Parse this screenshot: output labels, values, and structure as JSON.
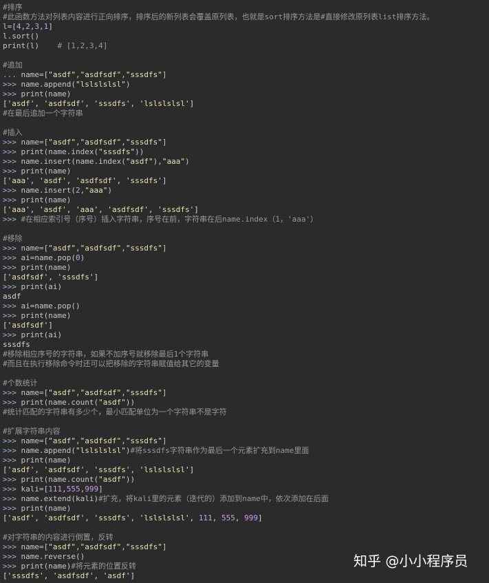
{
  "colors": {
    "background": "#2b2b2b",
    "text": "#c8c8c8",
    "comment": "#9a9a9a",
    "prompt": "#9cb6d8",
    "string": "#e9e4b0",
    "number": "#c8a2e6"
  },
  "watermark": "知乎 @小小程序员",
  "lines": [
    [
      {
        "t": "#排序",
        "k": "comment"
      }
    ],
    [
      {
        "t": "#此函数方法对列表内容进行正向排序，排序后的新列表会覆盖原列表，也就是sort排序方法是#直接修改原列表list排序方法。",
        "k": "comment"
      }
    ],
    [
      {
        "t": "l=[",
        "k": "default"
      },
      {
        "t": "4",
        "k": "number"
      },
      {
        "t": ",",
        "k": "default"
      },
      {
        "t": "2",
        "k": "number"
      },
      {
        "t": ",",
        "k": "default"
      },
      {
        "t": "3",
        "k": "number"
      },
      {
        "t": ",",
        "k": "default"
      },
      {
        "t": "1",
        "k": "number"
      },
      {
        "t": "]",
        "k": "default"
      }
    ],
    [
      {
        "t": "l.sort()",
        "k": "default"
      }
    ],
    [
      {
        "t": "print(l)    ",
        "k": "default"
      },
      {
        "t": "# [1,2,3,4]",
        "k": "comment"
      }
    ],
    [],
    [
      {
        "t": "#追加",
        "k": "comment"
      }
    ],
    [
      {
        "t": "... ",
        "k": "prompt"
      },
      {
        "t": "name=[",
        "k": "default"
      },
      {
        "t": "\"asdf\"",
        "k": "string"
      },
      {
        "t": ",",
        "k": "default"
      },
      {
        "t": "\"asdfsdf\"",
        "k": "string"
      },
      {
        "t": ",",
        "k": "default"
      },
      {
        "t": "\"sssdfs\"",
        "k": "string"
      },
      {
        "t": "]",
        "k": "default"
      }
    ],
    [
      {
        "t": ">>> ",
        "k": "prompt"
      },
      {
        "t": "name.append(",
        "k": "default"
      },
      {
        "t": "\"lslslslsl\"",
        "k": "string"
      },
      {
        "t": ")",
        "k": "default"
      }
    ],
    [
      {
        "t": ">>> ",
        "k": "prompt"
      },
      {
        "t": "print(name)",
        "k": "default"
      }
    ],
    [
      {
        "t": "[",
        "k": "output"
      },
      {
        "t": "'asdf'",
        "k": "string"
      },
      {
        "t": ", ",
        "k": "output"
      },
      {
        "t": "'asdfsdf'",
        "k": "string"
      },
      {
        "t": ", ",
        "k": "output"
      },
      {
        "t": "'sssdfs'",
        "k": "string"
      },
      {
        "t": ", ",
        "k": "output"
      },
      {
        "t": "'lslslslsl'",
        "k": "string"
      },
      {
        "t": "]",
        "k": "output"
      }
    ],
    [
      {
        "t": "#在最后追加一个字符串",
        "k": "comment"
      }
    ],
    [],
    [
      {
        "t": "#插入",
        "k": "comment"
      }
    ],
    [
      {
        "t": ">>> ",
        "k": "prompt"
      },
      {
        "t": "name=[",
        "k": "default"
      },
      {
        "t": "\"asdf\"",
        "k": "string"
      },
      {
        "t": ",",
        "k": "default"
      },
      {
        "t": "\"asdfsdf\"",
        "k": "string"
      },
      {
        "t": ",",
        "k": "default"
      },
      {
        "t": "\"sssdfs\"",
        "k": "string"
      },
      {
        "t": "]",
        "k": "default"
      }
    ],
    [
      {
        "t": ">>> ",
        "k": "prompt"
      },
      {
        "t": "print(name.index(",
        "k": "default"
      },
      {
        "t": "\"sssdfs\"",
        "k": "string"
      },
      {
        "t": "))",
        "k": "default"
      }
    ],
    [
      {
        "t": ">>> ",
        "k": "prompt"
      },
      {
        "t": "name.insert(name.index(",
        "k": "default"
      },
      {
        "t": "\"asdf\"",
        "k": "string"
      },
      {
        "t": "),",
        "k": "default"
      },
      {
        "t": "\"aaa\"",
        "k": "string"
      },
      {
        "t": ")",
        "k": "default"
      }
    ],
    [
      {
        "t": ">>> ",
        "k": "prompt"
      },
      {
        "t": "print(name)",
        "k": "default"
      }
    ],
    [
      {
        "t": "[",
        "k": "output"
      },
      {
        "t": "'aaa'",
        "k": "string"
      },
      {
        "t": ", ",
        "k": "output"
      },
      {
        "t": "'asdf'",
        "k": "string"
      },
      {
        "t": ", ",
        "k": "output"
      },
      {
        "t": "'asdfsdf'",
        "k": "string"
      },
      {
        "t": ", ",
        "k": "output"
      },
      {
        "t": "'sssdfs'",
        "k": "string"
      },
      {
        "t": "]",
        "k": "output"
      }
    ],
    [
      {
        "t": ">>> ",
        "k": "prompt"
      },
      {
        "t": "name.insert(",
        "k": "default"
      },
      {
        "t": "2",
        "k": "number"
      },
      {
        "t": ",",
        "k": "default"
      },
      {
        "t": "\"aaa\"",
        "k": "string"
      },
      {
        "t": ")",
        "k": "default"
      }
    ],
    [
      {
        "t": ">>> ",
        "k": "prompt"
      },
      {
        "t": "print(name)",
        "k": "default"
      }
    ],
    [
      {
        "t": "[",
        "k": "output"
      },
      {
        "t": "'aaa'",
        "k": "string"
      },
      {
        "t": ", ",
        "k": "output"
      },
      {
        "t": "'asdf'",
        "k": "string"
      },
      {
        "t": ", ",
        "k": "output"
      },
      {
        "t": "'aaa'",
        "k": "string"
      },
      {
        "t": ", ",
        "k": "output"
      },
      {
        "t": "'asdfsdf'",
        "k": "string"
      },
      {
        "t": ", ",
        "k": "output"
      },
      {
        "t": "'sssdfs'",
        "k": "string"
      },
      {
        "t": "]",
        "k": "output"
      }
    ],
    [
      {
        "t": ">>> ",
        "k": "prompt"
      },
      {
        "t": "#在相应索引号（序号）插入字符串，序号在前，字符串在后name.index（1，'aaa'）",
        "k": "comment"
      }
    ],
    [],
    [
      {
        "t": "#移除",
        "k": "comment"
      }
    ],
    [
      {
        "t": ">>> ",
        "k": "prompt"
      },
      {
        "t": "name=[",
        "k": "default"
      },
      {
        "t": "\"asdf\"",
        "k": "string"
      },
      {
        "t": ",",
        "k": "default"
      },
      {
        "t": "\"asdfsdf\"",
        "k": "string"
      },
      {
        "t": ",",
        "k": "default"
      },
      {
        "t": "\"sssdfs\"",
        "k": "string"
      },
      {
        "t": "]",
        "k": "default"
      }
    ],
    [
      {
        "t": ">>> ",
        "k": "prompt"
      },
      {
        "t": "ai=name.pop(",
        "k": "default"
      },
      {
        "t": "0",
        "k": "number"
      },
      {
        "t": ")",
        "k": "default"
      }
    ],
    [
      {
        "t": ">>> ",
        "k": "prompt"
      },
      {
        "t": "print(name)",
        "k": "default"
      }
    ],
    [
      {
        "t": "[",
        "k": "output"
      },
      {
        "t": "'asdfsdf'",
        "k": "string"
      },
      {
        "t": ", ",
        "k": "output"
      },
      {
        "t": "'sssdfs'",
        "k": "string"
      },
      {
        "t": "]",
        "k": "output"
      }
    ],
    [
      {
        "t": ">>> ",
        "k": "prompt"
      },
      {
        "t": "print(ai)",
        "k": "default"
      }
    ],
    [
      {
        "t": "asdf",
        "k": "output"
      }
    ],
    [
      {
        "t": ">>> ",
        "k": "prompt"
      },
      {
        "t": "ai=name.pop()",
        "k": "default"
      }
    ],
    [
      {
        "t": ">>> ",
        "k": "prompt"
      },
      {
        "t": "print(name)",
        "k": "default"
      }
    ],
    [
      {
        "t": "[",
        "k": "output"
      },
      {
        "t": "'asdfsdf'",
        "k": "string"
      },
      {
        "t": "]",
        "k": "output"
      }
    ],
    [
      {
        "t": ">>> ",
        "k": "prompt"
      },
      {
        "t": "print(ai)",
        "k": "default"
      }
    ],
    [
      {
        "t": "sssdfs",
        "k": "output"
      }
    ],
    [
      {
        "t": "#移除相应序号的字符串，如果不加序号就移除最后1个字符串",
        "k": "comment"
      }
    ],
    [
      {
        "t": "#而且在执行移除命令时还可以把移除的字符串赋值给其它的变量",
        "k": "comment"
      }
    ],
    [],
    [
      {
        "t": "#个数统计",
        "k": "comment"
      }
    ],
    [
      {
        "t": ">>> ",
        "k": "prompt"
      },
      {
        "t": "name=[",
        "k": "default"
      },
      {
        "t": "\"asdf\"",
        "k": "string"
      },
      {
        "t": ",",
        "k": "default"
      },
      {
        "t": "\"asdfsdf\"",
        "k": "string"
      },
      {
        "t": ",",
        "k": "default"
      },
      {
        "t": "\"sssdfs\"",
        "k": "string"
      },
      {
        "t": "]",
        "k": "default"
      }
    ],
    [
      {
        "t": ">>> ",
        "k": "prompt"
      },
      {
        "t": "print(name.count(",
        "k": "default"
      },
      {
        "t": "\"asdf\"",
        "k": "string"
      },
      {
        "t": "))",
        "k": "default"
      }
    ],
    [
      {
        "t": "#统计匹配的字符串有多少个，最小匹配单位为一个字符串不是字符",
        "k": "comment"
      }
    ],
    [],
    [
      {
        "t": "#扩展字符串内容",
        "k": "comment"
      }
    ],
    [
      {
        "t": ">>> ",
        "k": "prompt"
      },
      {
        "t": "name=[",
        "k": "default"
      },
      {
        "t": "\"asdf\"",
        "k": "string"
      },
      {
        "t": ",",
        "k": "default"
      },
      {
        "t": "\"asdfsdf\"",
        "k": "string"
      },
      {
        "t": ",",
        "k": "default"
      },
      {
        "t": "\"sssdfs\"",
        "k": "string"
      },
      {
        "t": "]",
        "k": "default"
      }
    ],
    [
      {
        "t": ">>> ",
        "k": "prompt"
      },
      {
        "t": "name.append(",
        "k": "default"
      },
      {
        "t": "\"lslslslsl\"",
        "k": "string"
      },
      {
        "t": ")",
        "k": "default"
      },
      {
        "t": "#将sssdfs字符串作为最后一个元素扩充到name里面",
        "k": "comment"
      }
    ],
    [
      {
        "t": ">>> ",
        "k": "prompt"
      },
      {
        "t": "print(name)",
        "k": "default"
      }
    ],
    [
      {
        "t": "[",
        "k": "output"
      },
      {
        "t": "'asdf'",
        "k": "string"
      },
      {
        "t": ", ",
        "k": "output"
      },
      {
        "t": "'asdfsdf'",
        "k": "string"
      },
      {
        "t": ", ",
        "k": "output"
      },
      {
        "t": "'sssdfs'",
        "k": "string"
      },
      {
        "t": ", ",
        "k": "output"
      },
      {
        "t": "'lslslslsl'",
        "k": "string"
      },
      {
        "t": "]",
        "k": "output"
      }
    ],
    [
      {
        "t": ">>> ",
        "k": "prompt"
      },
      {
        "t": "print(name.count(",
        "k": "default"
      },
      {
        "t": "\"asdf\"",
        "k": "string"
      },
      {
        "t": "))",
        "k": "default"
      }
    ],
    [
      {
        "t": ">>> ",
        "k": "prompt"
      },
      {
        "t": "kali=[",
        "k": "default"
      },
      {
        "t": "111",
        "k": "number"
      },
      {
        "t": ",",
        "k": "default"
      },
      {
        "t": "555",
        "k": "number"
      },
      {
        "t": ",",
        "k": "default"
      },
      {
        "t": "999",
        "k": "number"
      },
      {
        "t": "]",
        "k": "default"
      }
    ],
    [
      {
        "t": ">>> ",
        "k": "prompt"
      },
      {
        "t": "name.extend(kali)",
        "k": "default"
      },
      {
        "t": "#扩充，将kali里的元素（迭代的）添加到name中，依次添加在后面",
        "k": "comment"
      }
    ],
    [
      {
        "t": ">>> ",
        "k": "prompt"
      },
      {
        "t": "print(name)",
        "k": "default"
      }
    ],
    [
      {
        "t": "[",
        "k": "output"
      },
      {
        "t": "'asdf'",
        "k": "string"
      },
      {
        "t": ", ",
        "k": "output"
      },
      {
        "t": "'asdfsdf'",
        "k": "string"
      },
      {
        "t": ", ",
        "k": "output"
      },
      {
        "t": "'sssdfs'",
        "k": "string"
      },
      {
        "t": ", ",
        "k": "output"
      },
      {
        "t": "'lslslslsl'",
        "k": "string"
      },
      {
        "t": ", ",
        "k": "output"
      },
      {
        "t": "111",
        "k": "number"
      },
      {
        "t": ", ",
        "k": "output"
      },
      {
        "t": "555",
        "k": "number"
      },
      {
        "t": ", ",
        "k": "output"
      },
      {
        "t": "999",
        "k": "number"
      },
      {
        "t": "]",
        "k": "output"
      }
    ],
    [],
    [
      {
        "t": "#对字符串的内容进行倒置，反转",
        "k": "comment"
      }
    ],
    [
      {
        "t": ">>> ",
        "k": "prompt"
      },
      {
        "t": "name=[",
        "k": "default"
      },
      {
        "t": "\"asdf\"",
        "k": "string"
      },
      {
        "t": ",",
        "k": "default"
      },
      {
        "t": "\"asdfsdf\"",
        "k": "string"
      },
      {
        "t": ",",
        "k": "default"
      },
      {
        "t": "\"sssdfs\"",
        "k": "string"
      },
      {
        "t": "]",
        "k": "default"
      }
    ],
    [
      {
        "t": ">>> ",
        "k": "prompt"
      },
      {
        "t": "name.reverse()",
        "k": "default"
      }
    ],
    [
      {
        "t": ">>> ",
        "k": "prompt"
      },
      {
        "t": "print(name)",
        "k": "default"
      },
      {
        "t": "#将元素的位置反转",
        "k": "comment"
      }
    ],
    [
      {
        "t": "[",
        "k": "output"
      },
      {
        "t": "'sssdfs'",
        "k": "string"
      },
      {
        "t": ", ",
        "k": "output"
      },
      {
        "t": "'asdfsdf'",
        "k": "string"
      },
      {
        "t": ", ",
        "k": "output"
      },
      {
        "t": "'asdf'",
        "k": "string"
      },
      {
        "t": "]",
        "k": "output"
      }
    ]
  ]
}
